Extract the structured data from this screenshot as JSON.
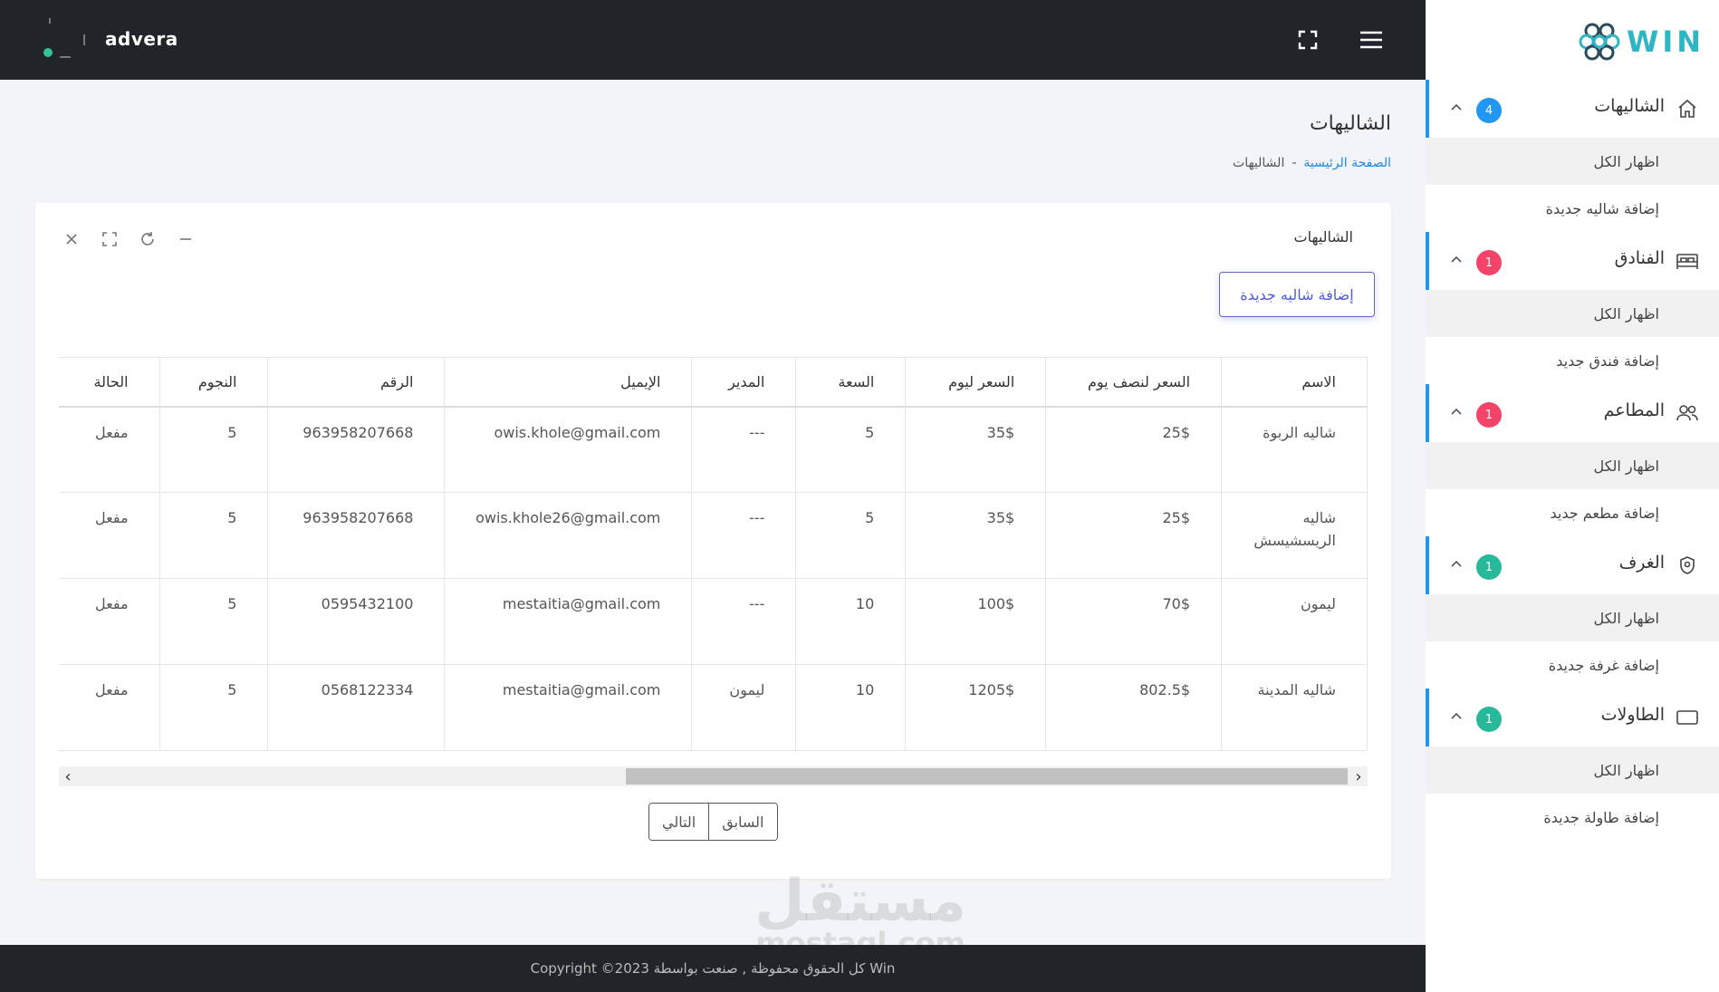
{
  "topbar": {
    "brand": "advera"
  },
  "page": {
    "title": "الشاليهات",
    "breadcrumb": {
      "home": "الصفحة الرئيسية",
      "separator": "-",
      "current": "الشاليهات"
    }
  },
  "card": {
    "title": "الشاليهات",
    "add_button": "إضافة شاليه جديدة"
  },
  "table": {
    "headers": [
      "الاسم",
      "السعر لنصف يوم",
      "السعر ليوم",
      "السعة",
      "المدير",
      "الإيميل",
      "الرقم",
      "النجوم",
      "الحالة"
    ],
    "rows": [
      [
        "شاليه الربوة",
        "25$",
        "35$",
        "5",
        "---",
        "owis.khole@gmail.com",
        "963958207668",
        "5",
        "مفعل"
      ],
      [
        "شاليه الريسشيسش",
        "25$",
        "35$",
        "5",
        "---",
        "owis.khole26@gmail.com",
        "963958207668",
        "5",
        "مفعل"
      ],
      [
        "ليمون",
        "70$",
        "100$",
        "10",
        "---",
        "mestaitia@gmail.com",
        "0595432100",
        "5",
        "مفعل"
      ],
      [
        "شاليه المدينة",
        "802.5$",
        "1205$",
        "10",
        "ليمون",
        "mestaitia@gmail.com",
        "0568122334",
        "5",
        "مفعل"
      ]
    ]
  },
  "pager": {
    "previous": "السابق",
    "next": "التالي"
  },
  "footer": {
    "text": "Win كل الحقوق محفوظة , صنعت بواسطة Copyright ©2023"
  },
  "watermark": {
    "arabic": "مستقل",
    "latin": "mostaql.com"
  },
  "sidebar": {
    "logo_text": "WIN",
    "groups": [
      {
        "label": "الشاليهات",
        "badge": "4",
        "badge_color": "#2196f3",
        "icon": "home-icon",
        "items": [
          "اظهار الكل",
          "إضافة شاليه جديدة"
        ]
      },
      {
        "label": "الفنادق",
        "badge": "1",
        "badge_color": "#f44369",
        "icon": "bed-icon",
        "items": [
          "اظهار الكل",
          "إضافة فندق جديد"
        ]
      },
      {
        "label": "المطاعم",
        "badge": "1",
        "badge_color": "#f44369",
        "icon": "users-icon",
        "items": [
          "اظهار الكل",
          "إضافة مطعم جديد"
        ]
      },
      {
        "label": "الغرف",
        "badge": "1",
        "badge_color": "#26b99a",
        "icon": "shield-icon",
        "items": [
          "اظهار الكل",
          "إضافة غرفة جديدة"
        ]
      },
      {
        "label": "الطاولات",
        "badge": "1",
        "badge_color": "#26b99a",
        "icon": "table-icon",
        "items": [
          "اظهار الكل",
          "إضافة طاولة جديدة"
        ]
      }
    ]
  }
}
